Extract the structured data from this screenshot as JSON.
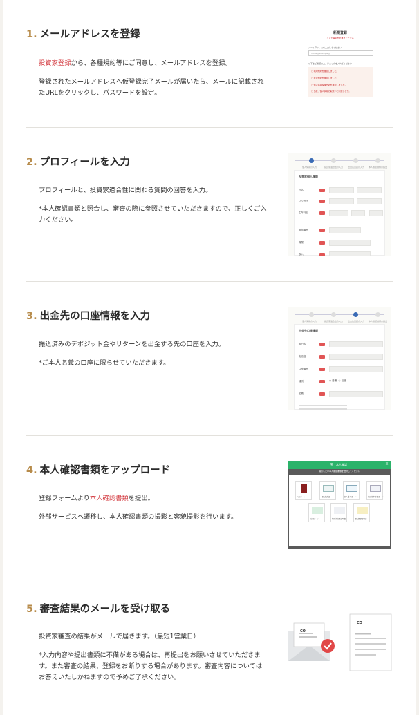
{
  "steps": [
    {
      "num": "1.",
      "title": "メールアドレスを登録",
      "link": "投資家登録",
      "body1_rest": "から、各種規約等にご同意し、メールアドレスを登録。",
      "body2": "登録されたメールアドレスへ仮登録完了メールが届いたら、メールに記載されたURLをクリックし、パスワードを設定。"
    },
    {
      "num": "2.",
      "title": "プロフィールを入力",
      "body1": "プロフィールと、投資家適合性に関わる質問の回答を入力。",
      "body2": "*本人確認書類と照合し、審査の際に参照させていただきますので、正しくご入力ください。"
    },
    {
      "num": "3.",
      "title": "出金先の口座情報を入力",
      "body1": "振込済みのデポジット金やリターンを出金する先の口座を入力。",
      "body2": "*ご本人名義の口座に限らせていただきます。"
    },
    {
      "num": "4.",
      "title": "本人確認書類をアップロード",
      "body1_pre": "登録フォームより",
      "link": "本人確認書類",
      "body1_post": "を提出。",
      "body2": "外部サービスへ遷移し、本人確認書類の撮影と容貌撮影を行います。"
    },
    {
      "num": "5.",
      "title": "審査結果のメールを受け取る",
      "body1": "投資家審査の結果がメールで届きます。（最短1営業日）",
      "body2": "*入力内容や提出書類に不備がある場合は、再提出をお願いさせていただきます。また審査の結果、登録をお断りする場合があります。審査内容についてはお答えいたしかねますので予めご了承ください。"
    }
  ],
  "thumb1": {
    "title": "新規登録",
    "subtitle": "ご入力事項をお書きください",
    "field_label": "メールアドレスを入力してください",
    "field_value": "name@example.jp",
    "check_heading": "以下をご確認の上、チェックを入れてください",
    "checks": [
      "利用規約を確認しました。",
      "投資規約を確認しました。",
      "個人情報保護方針を確認しました。",
      "当社、個人情報の取扱いに同意します。"
    ]
  },
  "thumb2": {
    "steps": [
      "個人情報の入力",
      "投資家適合性の入力",
      "出金先口座の入力",
      "本人確認書類の提出"
    ],
    "heading": "投資家個人情報",
    "rows": [
      {
        "label": "氏名",
        "values": [
          "姓",
          "名"
        ]
      },
      {
        "label": "フリガナ",
        "values": [
          "セイ",
          "メイ"
        ]
      },
      {
        "label": "生年月日",
        "values": [
          "1990",
          "1",
          "1"
        ]
      },
      {
        "label": "電話番号",
        "values": [
          "09012345678"
        ]
      },
      {
        "label": "職業",
        "values": [
          "選択してください"
        ]
      },
      {
        "label": "収入",
        "values": [
          "選択してください"
        ]
      }
    ]
  },
  "thumb3": {
    "steps": [
      "個人情報の入力",
      "投資家適合性の入力",
      "出金先口座の入力",
      "本人確認書類の提出"
    ],
    "heading": "出金先口座情報",
    "rows": [
      {
        "label": "銀行名",
        "values": [
          "銀行名を検索する"
        ]
      },
      {
        "label": "支店名",
        "values": [
          "支店名を検索する"
        ]
      },
      {
        "label": "口座番号",
        "values": [
          ""
        ]
      },
      {
        "label": "種別",
        "values": [
          "普通",
          "当座"
        ]
      },
      {
        "label": "名義",
        "values": [
          "ヤマダ タロウ"
        ]
      }
    ]
  },
  "thumb4": {
    "header": "本人確認",
    "close": "×",
    "banner": "撮影したい本人確認書類を選択してください",
    "docs": [
      "運転免許証",
      "個人番号カード",
      "パスポート",
      "住民基本台帳カード",
      "在留カード",
      "特別永住者証明書",
      "運転経歴証明書"
    ]
  },
  "thumb5": {
    "logo": "CO"
  },
  "colors": {
    "accent_number": "#b78b4a",
    "link_red": "#d2343a",
    "green_header": "#2bb36a",
    "check_red": "#e04a4a"
  }
}
